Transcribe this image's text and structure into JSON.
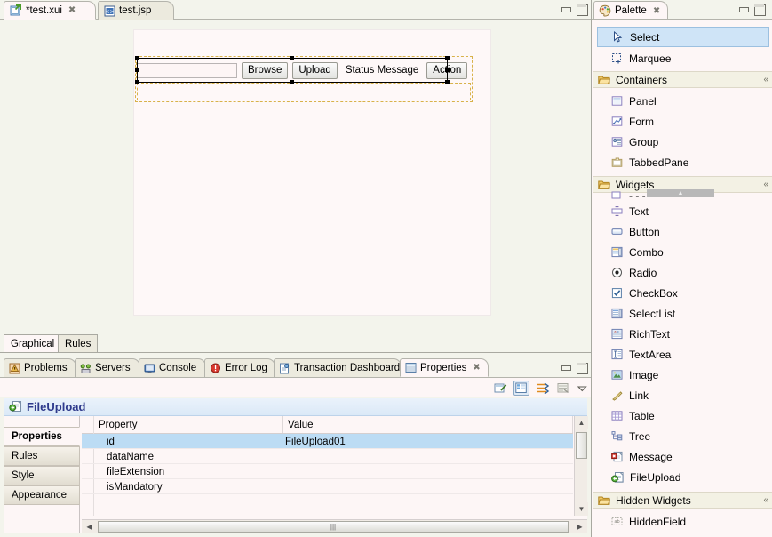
{
  "editor": {
    "tabs": [
      {
        "label": "*test.xui",
        "icon": "xui-file-icon",
        "active": true,
        "closeable": true
      },
      {
        "label": "test.jsp",
        "icon": "jsp-file-icon",
        "active": false,
        "closeable": false
      }
    ],
    "bottom_tabs": [
      {
        "label": "Graphical",
        "active": true
      },
      {
        "label": "Rules",
        "active": false
      }
    ],
    "window_buttons": {
      "minimize": "Minimize",
      "maximize": "Maximize"
    }
  },
  "canvas": {
    "widget": {
      "name": "FileUpload",
      "text_field_value": "",
      "text_field_placeholder": "",
      "browse_label": "Browse",
      "upload_label": "Upload",
      "status_label": "Status Message",
      "action_label": "Action"
    }
  },
  "bottom_view": {
    "tabs": [
      {
        "label": "Problems",
        "icon": "problems-icon",
        "active": false
      },
      {
        "label": "Servers",
        "icon": "servers-icon",
        "active": false
      },
      {
        "label": "Console",
        "icon": "console-icon",
        "active": false
      },
      {
        "label": "Error Log",
        "icon": "error-log-icon",
        "active": false
      },
      {
        "label": "Transaction Dashboard",
        "icon": "transaction-dashboard-icon",
        "active": false
      },
      {
        "label": "Properties",
        "icon": "properties-icon",
        "active": true
      }
    ],
    "toolbar": [
      {
        "name": "show-advanced-properties-icon",
        "pressed": false
      },
      {
        "name": "show-categories-icon",
        "pressed": true
      },
      {
        "name": "sort-properties-icon",
        "pressed": false
      },
      {
        "name": "restore-default-value-icon",
        "pressed": false
      },
      {
        "name": "view-menu-chevron-icon",
        "pressed": false
      }
    ]
  },
  "properties": {
    "title": "FileUpload",
    "title_icon": "fileupload-icon",
    "side_tabs": [
      {
        "label": "Properties",
        "active": true
      },
      {
        "label": "Rules",
        "active": false
      },
      {
        "label": "Style",
        "active": false
      },
      {
        "label": "Appearance",
        "active": false
      }
    ],
    "columns": [
      "Property",
      "Value"
    ],
    "rows": [
      {
        "property": "id",
        "value": "FileUpload01",
        "selected": true
      },
      {
        "property": "dataName",
        "value": "",
        "selected": false
      },
      {
        "property": "fileExtension",
        "value": "",
        "selected": false
      },
      {
        "property": "isMandatory",
        "value": "",
        "selected": false
      }
    ]
  },
  "palette": {
    "tab_label": "Palette",
    "tab_icon": "palette-icon",
    "tools": [
      {
        "label": "Select",
        "icon": "cursor-arrow-icon",
        "selected": true
      },
      {
        "label": "Marquee",
        "icon": "marquee-icon",
        "selected": false
      }
    ],
    "groups": [
      {
        "label": "Containers",
        "icon": "open-folder-icon",
        "items": [
          {
            "label": "Panel",
            "icon": "panel-icon"
          },
          {
            "label": "Form",
            "icon": "form-icon"
          },
          {
            "label": "Group",
            "icon": "group-icon"
          },
          {
            "label": "TabbedPane",
            "icon": "tabbedpane-icon"
          }
        ]
      },
      {
        "label": "Widgets",
        "icon": "open-folder-icon",
        "items": [
          {
            "label": "Text",
            "icon": "text-icon"
          },
          {
            "label": "Button",
            "icon": "button-icon"
          },
          {
            "label": "Combo",
            "icon": "combo-icon"
          },
          {
            "label": "Radio",
            "icon": "radio-icon"
          },
          {
            "label": "CheckBox",
            "icon": "checkbox-icon"
          },
          {
            "label": "SelectList",
            "icon": "selectlist-icon"
          },
          {
            "label": "RichText",
            "icon": "richtext-icon"
          },
          {
            "label": "TextArea",
            "icon": "textarea-icon"
          },
          {
            "label": "Image",
            "icon": "image-icon"
          },
          {
            "label": "Link",
            "icon": "link-icon"
          },
          {
            "label": "Table",
            "icon": "table-icon"
          },
          {
            "label": "Tree",
            "icon": "tree-icon"
          },
          {
            "label": "Message",
            "icon": "message-icon"
          },
          {
            "label": "FileUpload",
            "icon": "fileupload-icon"
          }
        ]
      },
      {
        "label": "Hidden Widgets",
        "icon": "open-folder-icon",
        "items": [
          {
            "label": "HiddenField",
            "icon": "hiddenfield-icon"
          }
        ]
      }
    ]
  },
  "colors": {
    "selection_blue": "#bcdcf4",
    "palette_selection": "#cfe4f7",
    "title_text": "#2e3a8c",
    "guide_orange": "#d8b24a",
    "panel_bg": "#fdf6f6",
    "editor_bg": "#f3f4ec"
  }
}
